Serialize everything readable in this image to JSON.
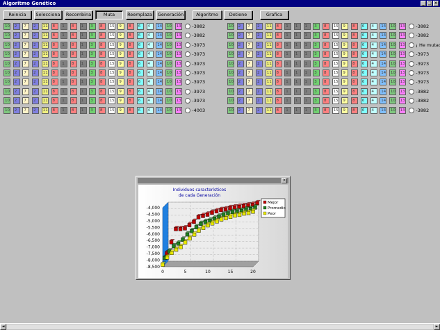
{
  "window": {
    "title": "Algoritmo Genético"
  },
  "toolbar": {
    "buttons": [
      "Reinicia",
      "Selecciona",
      "Recombina",
      "Muta",
      "Reemplaza",
      "Generación",
      "Algoritmo",
      "Detiene",
      "Grafica"
    ]
  },
  "palette": {
    "10": "#7fc87f",
    "7": "#fff4c8",
    "11": "#f0f080",
    "2": "#8080e0",
    "1": "#808080",
    "3": "#70d070",
    "15": "#ffffff",
    "9": "#ffffa0",
    "8": "#ff8080",
    "6": "#80ffff",
    "4": "#c0ffff",
    "14": "#80c0ff",
    "5": "#ffff80",
    "13": "#ff80ff",
    "12": "#ffb0ff"
  },
  "population": {
    "left": {
      "rows": [
        {
          "genes": [
            "10",
            "2",
            "7",
            "2",
            "11",
            "8",
            "1",
            "8",
            "1",
            "3",
            "8",
            "15",
            "9",
            "8",
            "6",
            "4",
            "14",
            "10",
            "13"
          ],
          "fitness": "-3882"
        },
        {
          "genes": [
            "10",
            "2",
            "7",
            "2",
            "11",
            "8",
            "1",
            "8",
            "1",
            "3",
            "8",
            "15",
            "9",
            "8",
            "6",
            "4",
            "14",
            "10",
            "13"
          ],
          "fitness": "-3882"
        },
        {
          "genes": [
            "10",
            "2",
            "7",
            "2",
            "11",
            "8",
            "1",
            "8",
            "1",
            "3",
            "8",
            "15",
            "9",
            "8",
            "6",
            "4",
            "14",
            "10",
            "13"
          ],
          "fitness": "-3973"
        },
        {
          "genes": [
            "10",
            "2",
            "7",
            "2",
            "11",
            "8",
            "1",
            "8",
            "1",
            "3",
            "8",
            "15",
            "9",
            "8",
            "6",
            "4",
            "14",
            "10",
            "13"
          ],
          "fitness": "-3973"
        },
        {
          "genes": [
            "10",
            "2",
            "7",
            "2",
            "11",
            "8",
            "1",
            "8",
            "1",
            "3",
            "8",
            "15",
            "9",
            "8",
            "6",
            "4",
            "14",
            "10",
            "13"
          ],
          "fitness": "-3973"
        },
        {
          "genes": [
            "10",
            "2",
            "7",
            "2",
            "11",
            "8",
            "1",
            "8",
            "1",
            "3",
            "8",
            "15",
            "9",
            "8",
            "6",
            "4",
            "14",
            "10",
            "13"
          ],
          "fitness": "-3973"
        },
        {
          "genes": [
            "10",
            "2",
            "7",
            "2",
            "11",
            "8",
            "1",
            "8",
            "1",
            "3",
            "8",
            "15",
            "9",
            "8",
            "6",
            "4",
            "14",
            "10",
            "13"
          ],
          "fitness": "-3973"
        },
        {
          "genes": [
            "10",
            "2",
            "7",
            "2",
            "11",
            "8",
            "1",
            "8",
            "1",
            "3",
            "8",
            "15",
            "9",
            "8",
            "6",
            "4",
            "14",
            "10",
            "13"
          ],
          "fitness": "-3973"
        },
        {
          "genes": [
            "10",
            "2",
            "7",
            "2",
            "11",
            "8",
            "1",
            "8",
            "1",
            "3",
            "8",
            "15",
            "9",
            "8",
            "6",
            "4",
            "14",
            "10",
            "13"
          ],
          "fitness": "-3973"
        },
        {
          "genes": [
            "10",
            "2",
            "7",
            "2",
            "11",
            "8",
            "1",
            "8",
            "1",
            "3",
            "8",
            "15",
            "9",
            "8",
            "6",
            "4",
            "14",
            "10",
            "13"
          ],
          "fitness": "-4003"
        }
      ]
    },
    "right": {
      "rows": [
        {
          "genes": [
            "10",
            "2",
            "7",
            "2",
            "11",
            "8",
            "1",
            "1",
            "1",
            "3",
            "8",
            "15",
            "9",
            "8",
            "6",
            "4",
            "14",
            "10",
            "13"
          ],
          "fitness": "-3882"
        },
        {
          "genes": [
            "10",
            "2",
            "7",
            "2",
            "11",
            "8",
            "1",
            "1",
            "1",
            "3",
            "8",
            "15",
            "9",
            "8",
            "6",
            "4",
            "14",
            "10",
            "13"
          ],
          "fitness": "-3882"
        },
        {
          "genes": [
            "10",
            "2",
            "7",
            "2",
            "11",
            "8",
            "1",
            "1",
            "1",
            "3",
            "8",
            "15",
            "9",
            "8",
            "6",
            "4",
            "14",
            "10",
            "13"
          ],
          "fitness": "¡ He mutado !"
        },
        {
          "genes": [
            "10",
            "2",
            "7",
            "2",
            "11",
            "8",
            "1",
            "1",
            "1",
            "3",
            "8",
            "15",
            "9",
            "8",
            "6",
            "4",
            "14",
            "10",
            "13"
          ],
          "fitness": "-3973"
        },
        {
          "genes": [
            "10",
            "2",
            "7",
            "2",
            "11",
            "8",
            "1",
            "1",
            "1",
            "3",
            "8",
            "15",
            "9",
            "8",
            "6",
            "4",
            "14",
            "10",
            "13"
          ],
          "fitness": "-3973"
        },
        {
          "genes": [
            "10",
            "2",
            "7",
            "2",
            "11",
            "8",
            "1",
            "1",
            "1",
            "3",
            "8",
            "15",
            "9",
            "8",
            "6",
            "4",
            "14",
            "10",
            "13"
          ],
          "fitness": "-3973"
        },
        {
          "genes": [
            "10",
            "2",
            "7",
            "2",
            "11",
            "8",
            "1",
            "1",
            "1",
            "3",
            "8",
            "15",
            "9",
            "8",
            "6",
            "4",
            "14",
            "10",
            "13"
          ],
          "fitness": "-3973"
        },
        {
          "genes": [
            "10",
            "2",
            "7",
            "2",
            "11",
            "8",
            "1",
            "1",
            "1",
            "3",
            "8",
            "15",
            "9",
            "8",
            "6",
            "4",
            "14",
            "10",
            "13"
          ],
          "fitness": "-3882"
        },
        {
          "genes": [
            "10",
            "2",
            "7",
            "2",
            "11",
            "8",
            "1",
            "1",
            "1",
            "3",
            "8",
            "15",
            "9",
            "8",
            "6",
            "4",
            "14",
            "10",
            "13"
          ],
          "fitness": "-3882"
        },
        {
          "genes": [
            "10",
            "2",
            "7",
            "2",
            "11",
            "8",
            "1",
            "1",
            "1",
            "3",
            "8",
            "15",
            "9",
            "8",
            "6",
            "4",
            "14",
            "10",
            "13"
          ],
          "fitness": "-3882"
        }
      ]
    }
  },
  "chart_data": {
    "type": "bar",
    "title": "Individuos característicos",
    "subtitle": "de cada Generación",
    "legend_position": "top-right",
    "categories": [
      0,
      1,
      2,
      3,
      4,
      5,
      6,
      7,
      8,
      9,
      10,
      11,
      12,
      13,
      14,
      15,
      16,
      17,
      18,
      19,
      20
    ],
    "ylim": [
      -8500,
      -4000
    ],
    "yticks": [
      "-4,000",
      "-4,500",
      "-5,000",
      "-5,500",
      "-6,000",
      "-6,500",
      "-7,000",
      "-7,500",
      "-8,000",
      "-8,500"
    ],
    "xticks": [
      "0",
      "5",
      "10",
      "15",
      "20"
    ],
    "grid": true,
    "series": [
      {
        "name": "Mejor",
        "color": "#c00000",
        "values": [
          -7800,
          -6950,
          -5950,
          -5950,
          -5900,
          -5650,
          -5400,
          -5050,
          -4950,
          -4850,
          -4700,
          -4600,
          -4500,
          -4450,
          -4350,
          -4300,
          -4250,
          -4200,
          -4150,
          -4100,
          -3980
        ]
      },
      {
        "name": "Promedio",
        "color": "#208020",
        "values": [
          -8000,
          -7500,
          -7100,
          -6900,
          -6600,
          -6200,
          -5950,
          -5650,
          -5400,
          -5250,
          -5150,
          -5000,
          -4850,
          -4700,
          -4600,
          -4500,
          -4450,
          -4400,
          -4300,
          -4250,
          -4150
        ]
      },
      {
        "name": "Peor",
        "color": "#e8e800",
        "values": [
          -8350,
          -7800,
          -7450,
          -7200,
          -7000,
          -6650,
          -6350,
          -6050,
          -5750,
          -5550,
          -5350,
          -5200,
          -5050,
          -4900,
          -4800,
          -4700,
          -4600,
          -4550,
          -4450,
          -4400,
          -4300
        ]
      }
    ]
  }
}
